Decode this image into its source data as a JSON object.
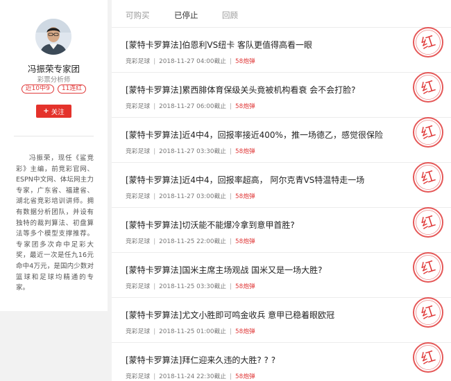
{
  "colors": {
    "accent": "#e4322b",
    "page_bg": "#f2f2f2"
  },
  "expert": {
    "name": "冯振荣专家团",
    "title": "彩票分析师",
    "badges": [
      "近10中9",
      "11连红"
    ],
    "follow_label": "关注",
    "bio": "冯振荣，现任《鲨竞彩》主编，前竞彩官网、ESPN中文网、体坛网主力专家，广东省、福建省、湖北省竞彩培训讲师。拥有数据分析团队，并设有独特的裁判算法、初盘算法等多个模型支撑推荐。专家团多次命中足彩大奖，最近一次是任九16元命中4万元，是国内少数对篮球和足球均精通的专家。"
  },
  "tabs": [
    {
      "label": "可购买",
      "active": false
    },
    {
      "label": "已停止",
      "active": true
    },
    {
      "label": "回顾",
      "active": false
    }
  ],
  "stamp_text": "红",
  "articles": [
    {
      "title": "[蒙特卡罗算法]伯恩利VS纽卡 客队更值得高看一眼",
      "category": "竞彩足球",
      "deadline": "2018-11-27 04:00截止",
      "price": "58炮弹"
    },
    {
      "title": "[蒙特卡罗算法]累西腓体育保级关头竟被机构看衰 会不会打脸?",
      "category": "竞彩足球",
      "deadline": "2018-11-27 06:00截止",
      "price": "58炮弹"
    },
    {
      "title": "[蒙特卡罗算法]近4中4，回报率接近400%，推一场德乙，感觉很保险",
      "category": "竞彩足球",
      "deadline": "2018-11-27 03:30截止",
      "price": "58炮弹"
    },
    {
      "title": "[蒙特卡罗算法]近4中4，回报率超高， 阿尔克青VS特温特走一场",
      "category": "竞彩足球",
      "deadline": "2018-11-27 03:00截止",
      "price": "58炮弹"
    },
    {
      "title": "[蒙特卡罗算法]切沃能不能爆冷拿到意甲首胜?",
      "category": "竞彩足球",
      "deadline": "2018-11-25 22:00截止",
      "price": "58炮弹"
    },
    {
      "title": "[蒙特卡罗算法]国米主席主场观战 国米又是一场大胜?",
      "category": "竞彩足球",
      "deadline": "2018-11-25 03:30截止",
      "price": "58炮弹"
    },
    {
      "title": "[蒙特卡罗算法]尤文小胜即可鸣金收兵 意甲已稳着眼欧冠",
      "category": "竞彩足球",
      "deadline": "2018-11-25 01:00截止",
      "price": "58炮弹"
    },
    {
      "title": "[蒙特卡罗算法]拜仁迎来久违的大胜? ? ?",
      "category": "竞彩足球",
      "deadline": "2018-11-24 22:30截止",
      "price": "58炮弹"
    }
  ]
}
